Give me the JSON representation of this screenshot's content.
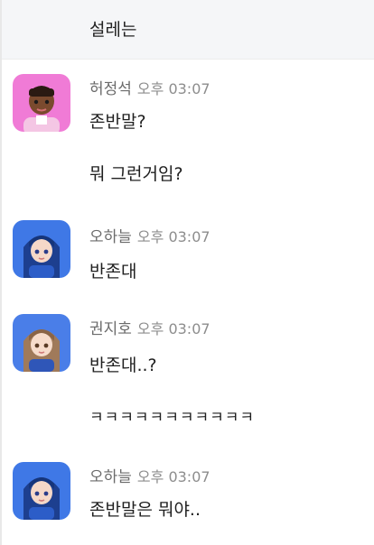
{
  "previous": {
    "text": "설레는"
  },
  "groups": [
    {
      "sender": "허정석",
      "time": "오후 03:07",
      "avatar_icon": "avatar-pink-character-icon",
      "messages": [
        "존반말?",
        "뭐 그런거임?"
      ]
    },
    {
      "sender": "오하늘",
      "time": "오후 03:07",
      "avatar_icon": "avatar-blue-hair-character-icon",
      "messages": [
        "반존대"
      ]
    },
    {
      "sender": "권지호",
      "time": "오후 03:07",
      "avatar_icon": "avatar-brown-hair-character-icon",
      "messages": [
        "반존대..?",
        "ㅋㅋㅋㅋㅋㅋㅋㅋㅋㅋㅋ"
      ]
    },
    {
      "sender": "오하늘",
      "time": "오후 03:07",
      "avatar_icon": "avatar-blue-hair-character-icon",
      "messages": [
        "존반말은 뭐야.."
      ]
    }
  ],
  "colors": {
    "pink_avatar_bg": "#f07bd6",
    "blue_avatar_bg": "#3f78e6",
    "brown_avatar_bg": "#4a7ee8"
  }
}
